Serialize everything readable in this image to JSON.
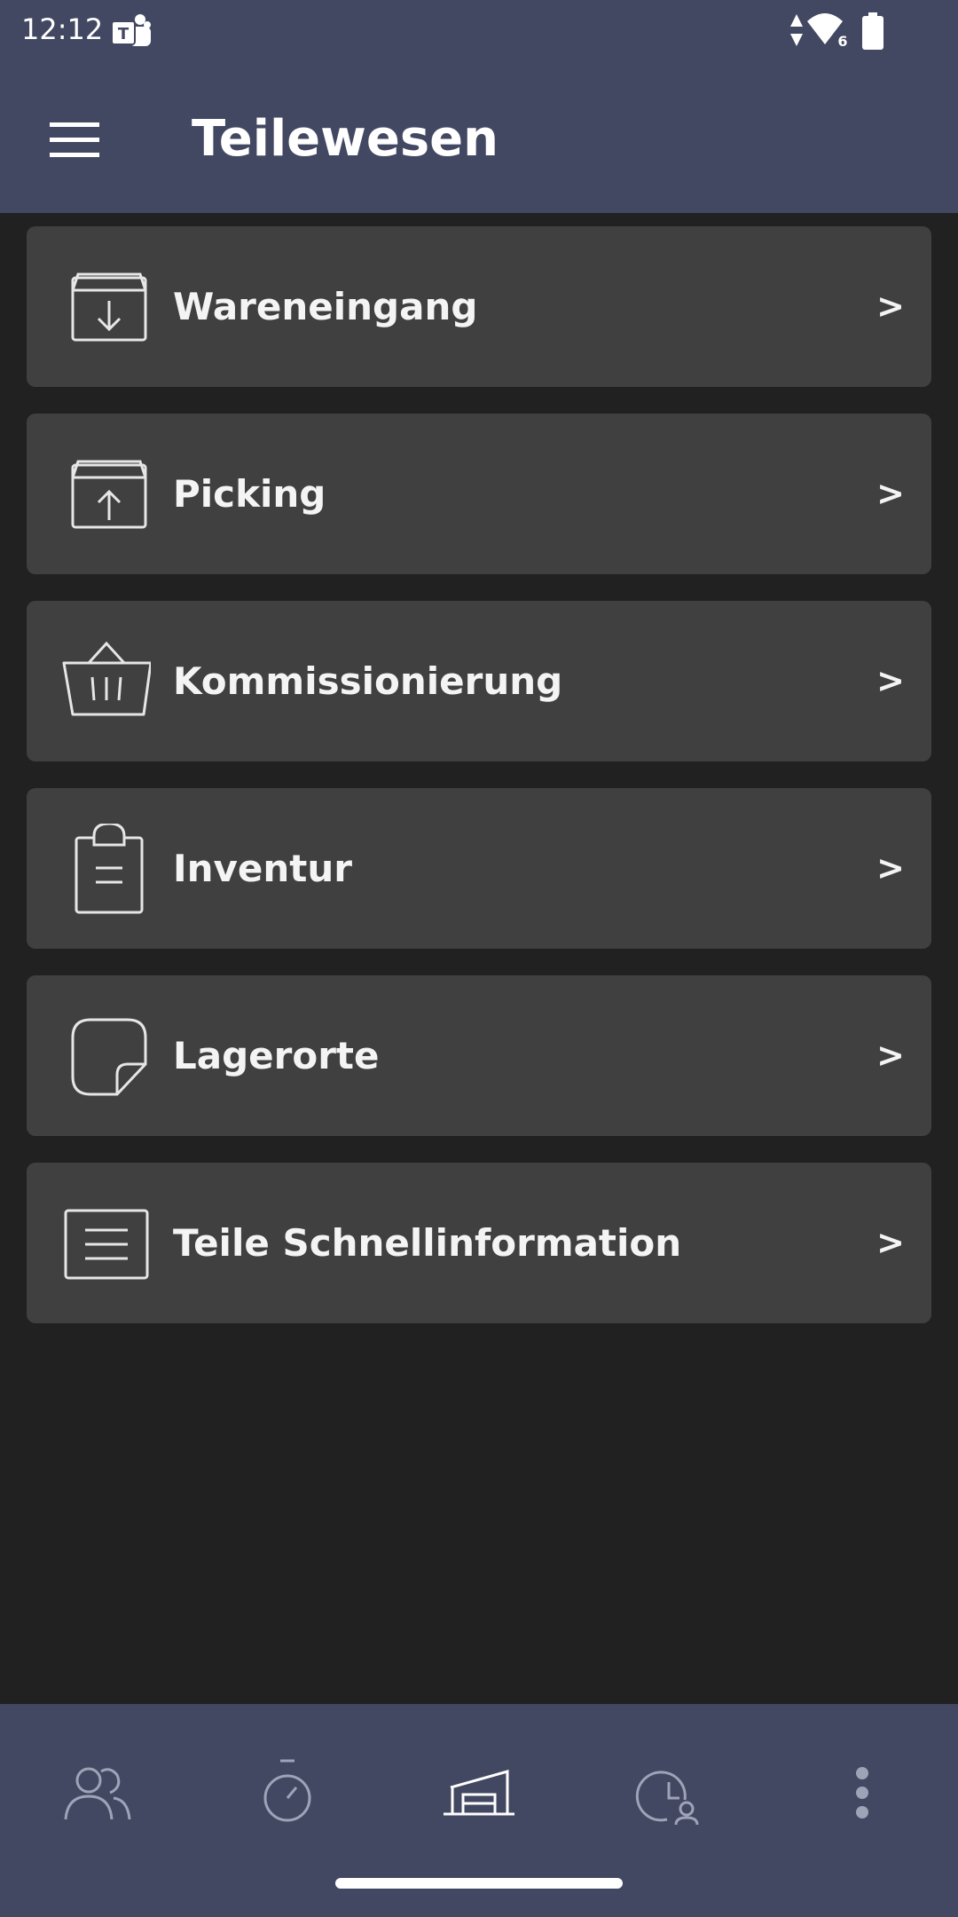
{
  "status_bar": {
    "time": "12:12",
    "network_label": "6",
    "icons": [
      "teams-icon",
      "signal-arrows-icon",
      "wifi-icon",
      "battery-icon"
    ]
  },
  "app_bar": {
    "title": "Teilewesen",
    "menu_icon": "hamburger-menu-icon"
  },
  "menu": {
    "items": [
      {
        "label": "Wareneingang",
        "icon": "box-download-icon",
        "chevron": ">"
      },
      {
        "label": "Picking",
        "icon": "box-upload-icon",
        "chevron": ">"
      },
      {
        "label": "Kommissionierung",
        "icon": "basket-icon",
        "chevron": ">"
      },
      {
        "label": "Inventur",
        "icon": "clipboard-icon",
        "chevron": ">"
      },
      {
        "label": "Lagerorte",
        "icon": "sticky-note-icon",
        "chevron": ">"
      },
      {
        "label": "Teile Schnellinformation",
        "icon": "document-lines-icon",
        "chevron": ">"
      }
    ]
  },
  "bottom_nav": {
    "items": [
      {
        "icon": "users-icon"
      },
      {
        "icon": "stopwatch-icon"
      },
      {
        "icon": "warehouse-icon",
        "active": true
      },
      {
        "icon": "time-user-icon"
      },
      {
        "icon": "more-vertical-icon"
      }
    ]
  },
  "colors": {
    "header_bg": "#434862",
    "page_bg": "#212121",
    "card_bg": "#404040",
    "text": "#ffffff",
    "inactive_icon": "#9fa3b8"
  }
}
